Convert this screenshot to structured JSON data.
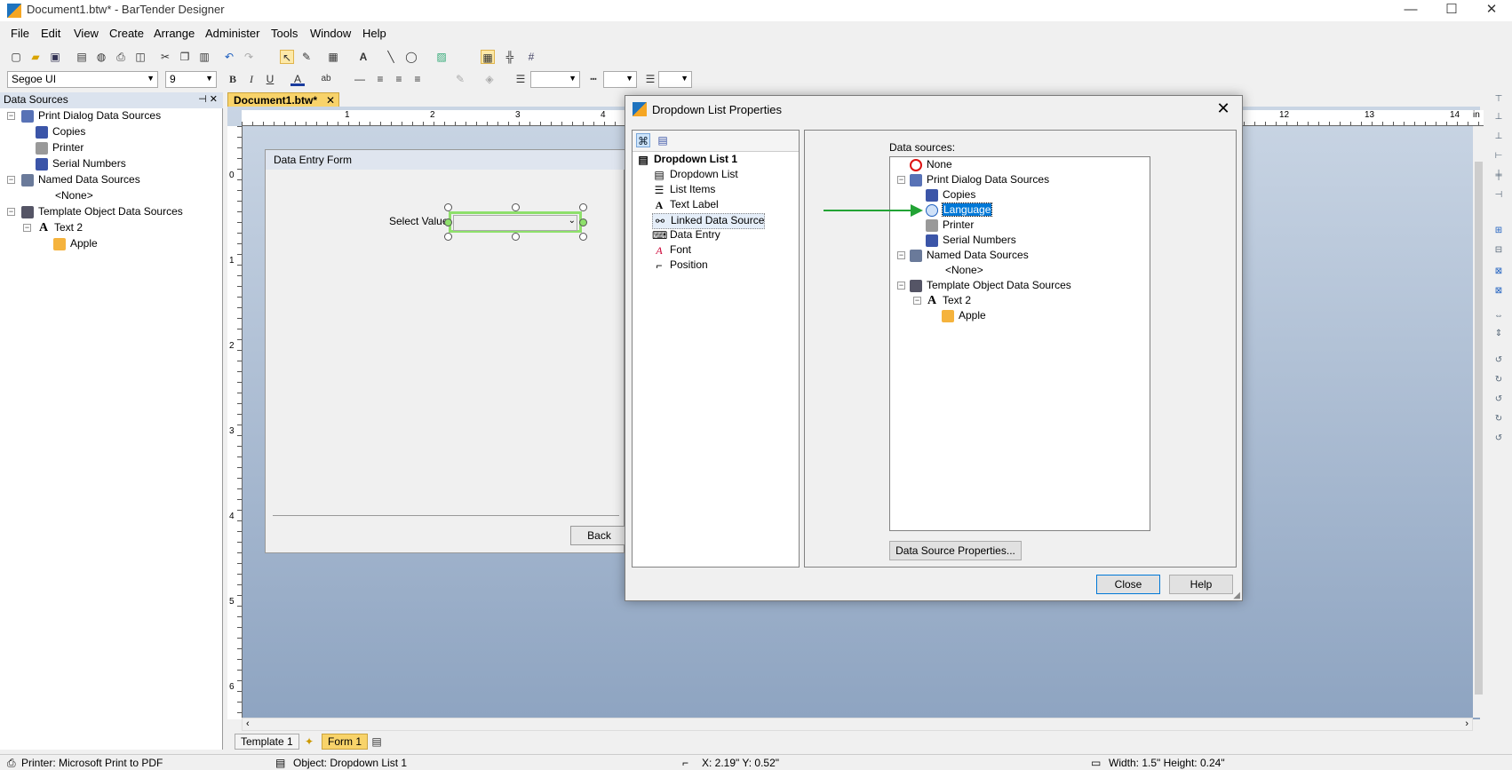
{
  "window": {
    "title": "Document1.btw* - BarTender Designer",
    "controls": {
      "minimize": "—",
      "maximize": "☐",
      "close": "✕"
    }
  },
  "menu": [
    "File",
    "Edit",
    "View",
    "Create",
    "Arrange",
    "Administer",
    "Tools",
    "Window",
    "Help"
  ],
  "format_toolbar": {
    "font": "Segoe UI",
    "size": "9",
    "bold": "B",
    "italic": "I",
    "underline": "U",
    "font_color": "A"
  },
  "data_sources_panel": {
    "header": "Data Sources",
    "pin": "⊣ ✕",
    "tree": [
      {
        "label": "Print Dialog Data Sources",
        "level": 0,
        "expander": "−",
        "icon": "print-dialog-icon"
      },
      {
        "label": "Copies",
        "level": 1,
        "icon": "copies-icon"
      },
      {
        "label": "Printer",
        "level": 1,
        "icon": "printer-icon"
      },
      {
        "label": "Serial Numbers",
        "level": 1,
        "icon": "serial-numbers-icon"
      },
      {
        "label": "Named Data Sources",
        "level": 0,
        "expander": "−",
        "icon": "named-data-icon"
      },
      {
        "label": "<None>",
        "level": 2,
        "icon": ""
      },
      {
        "label": "Template Object Data Sources",
        "level": 0,
        "expander": "−",
        "icon": "template-object-icon"
      },
      {
        "label": "Text 2",
        "level": 1,
        "expander": "−",
        "icon": "text-icon"
      },
      {
        "label": "Apple",
        "level": 2,
        "icon": "data-value-icon"
      }
    ]
  },
  "document_tab": {
    "label": "Document1.btw*",
    "close": "✕"
  },
  "ruler": {
    "h_ticks": [
      "1",
      "2",
      "3",
      "4",
      "12",
      "13",
      "14",
      "in"
    ],
    "v_ticks": [
      "0",
      "1",
      "2",
      "3",
      "4",
      "5",
      "6"
    ]
  },
  "form": {
    "title": "Data Entry Form",
    "select_label": "Select Value",
    "back_button": "Back"
  },
  "bottom_tabs": {
    "template": "Template 1",
    "form": "Form 1"
  },
  "status_bar": {
    "printer": "Printer: Microsoft Print to PDF",
    "object": "Object: Dropdown List 1",
    "position": "X: 2.19\"  Y: 0.52\"",
    "size": "Width: 1.5\"  Height: 0.24\""
  },
  "dialog": {
    "title": "Dropdown List Properties",
    "close": "✕",
    "nav": [
      {
        "label": "Dropdown List 1",
        "bold": true,
        "icon": "dropdown-list-icon"
      },
      {
        "label": "Dropdown List",
        "icon": "dropdown-list-icon"
      },
      {
        "label": "List Items",
        "icon": "list-items-icon"
      },
      {
        "label": "Text Label",
        "icon": "text-label-icon"
      },
      {
        "label": "Linked Data Source",
        "icon": "link-icon"
      },
      {
        "label": "Data Entry",
        "icon": "keyboard-icon"
      },
      {
        "label": "Font",
        "icon": "font-icon"
      },
      {
        "label": "Position",
        "icon": "position-icon"
      }
    ],
    "data_sources_label": "Data sources:",
    "ds_tree": [
      {
        "label": "None",
        "level": 0,
        "icon": "none-icon"
      },
      {
        "label": "Print Dialog Data Sources",
        "level": 0,
        "expander": "−",
        "icon": "print-dialog-icon"
      },
      {
        "label": "Copies",
        "level": 1,
        "icon": "copies-icon"
      },
      {
        "label": "Language",
        "level": 1,
        "icon": "globe-icon",
        "selected": true
      },
      {
        "label": "Printer",
        "level": 1,
        "icon": "printer-icon"
      },
      {
        "label": "Serial Numbers",
        "level": 1,
        "icon": "serial-numbers-icon"
      },
      {
        "label": "Named Data Sources",
        "level": 0,
        "expander": "−",
        "icon": "named-data-icon"
      },
      {
        "label": "<None>",
        "level": 2,
        "icon": ""
      },
      {
        "label": "Template Object Data Sources",
        "level": 0,
        "expander": "−",
        "icon": "template-object-icon"
      },
      {
        "label": "Text 2",
        "level": 1,
        "expander": "−",
        "icon": "text-icon"
      },
      {
        "label": "Apple",
        "level": 2,
        "icon": "data-value-icon"
      }
    ],
    "data_source_properties_button": "Data Source Properties...",
    "close_button": "Close",
    "help_button": "Help"
  },
  "colors": {
    "accent": "#0078d7",
    "selection_green": "#8ee06b",
    "arrow": "#22a335"
  }
}
